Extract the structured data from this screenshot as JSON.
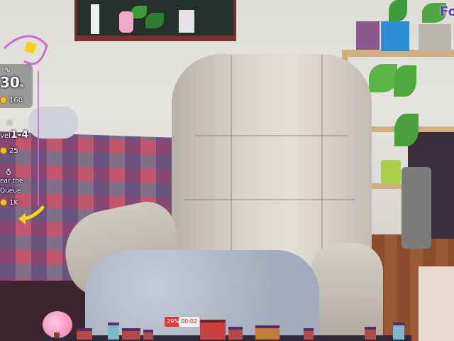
{
  "hud": {
    "timer_value": "30",
    "timer_unit": "s",
    "timer_coins": "160",
    "level_label": "vel",
    "level_value": "1-4",
    "level_coins": "25",
    "goal_line1": "ear the",
    "goal_line2": "Queue",
    "goal_coins": "1K"
  },
  "logo": {
    "text": "Fo"
  },
  "town": {
    "badge_percent": "29%",
    "badge_time": "00:02"
  },
  "colors": {
    "hud_accent": "#f5d318",
    "hud_frame": "#c86bd6",
    "logo": "#6a36c8"
  },
  "icons": {
    "timer": "wave-icon",
    "level": "shuffle-icon",
    "goal": "bottle-icon",
    "coin": "coin-icon"
  }
}
